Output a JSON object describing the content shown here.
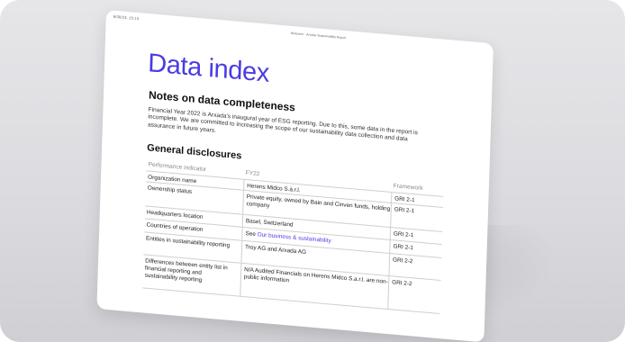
{
  "header": {
    "date": "6/30/23, 15:13",
    "report_title": "Welcome - Arxada Sustainability Report"
  },
  "title": "Data index",
  "completeness": {
    "heading": "Notes on data completeness",
    "text": "Financial Year 2022 is Arxada's inaugural year of ESG reporting. Due to this, some data in the report is incomplete. We are committed to increasing the scope of our sustainability data collection and data assurance in future years."
  },
  "disclosures": {
    "heading": "General disclosures",
    "columns": [
      "Performance indicator",
      "FY22",
      "Framework"
    ],
    "rows": [
      {
        "indicator": "Organization name",
        "value": "Herens Midco S.à.r.l.",
        "link": "",
        "framework": "GRI 2-1"
      },
      {
        "indicator": "Ownership status",
        "value": "Private equity, owned by Bain and Cinven funds, holding company",
        "link": "",
        "framework": "GRI 2-1"
      },
      {
        "indicator": "Headquarters location",
        "value": "Basel, Switzerland",
        "link": "",
        "framework": "GRI 2-1"
      },
      {
        "indicator": "Countries of operation",
        "value": "See ",
        "link": "Our business & sustainability",
        "framework": "GRI 2-1"
      },
      {
        "indicator": "Entities in sustainability reporting",
        "value": "Troy AG and Arxada AG",
        "link": "",
        "framework": "GRI 2-2"
      },
      {
        "indicator": "Differences between entity list in financial reporting and sustainability reporting",
        "value": "N/A Audited Financials on Herens Midco S.a.r.l. are non-public information",
        "link": "",
        "framework": "GRI 2-2"
      }
    ]
  }
}
